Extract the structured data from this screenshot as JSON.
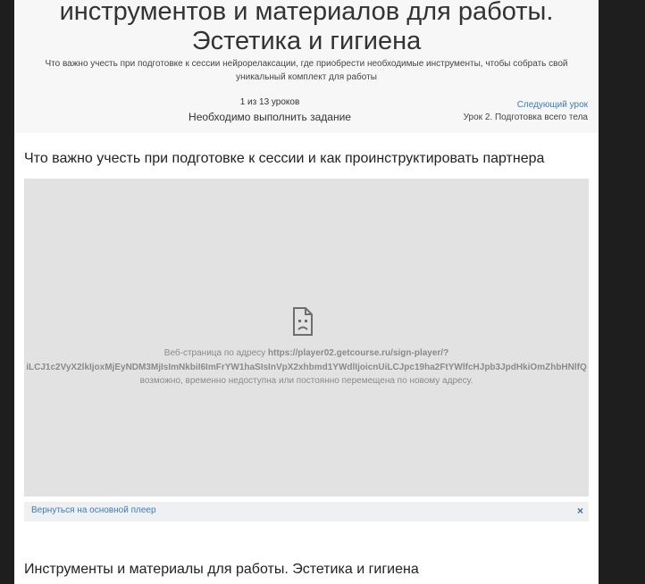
{
  "header": {
    "title_line_1": "инструментов и материалов для работы.",
    "title_line_2": "Эстетика и гигиена",
    "description": "Что важно учесть при подготовке к сессии нейрорелаксации, где приобрести необходимые инструменты, чтобы собрать свой уникальный комплект для работы",
    "progress": "1 из 13 уроков",
    "task_status": "Необходимо выполнить задание",
    "next_lesson_label": "Следующий урок",
    "next_lesson_title": "Урок 2. Подготовка всего тела"
  },
  "sections": [
    {
      "heading": "Что важно учесть при подготовке к сессии и как проинструктировать партнера"
    },
    {
      "heading": "Инструменты и материалы для работы. Эстетика и гигиена"
    }
  ],
  "player": {
    "error_prefix": "Веб-страница по адресу ",
    "error_url": "https://player02.getcourse.ru/sign-player/?",
    "error_url_cont": "iLCJ1c2VyX2lkIjoxMjEyNDM3MjIsImNkbiI6ImFrYW1haSIsInVpX2xhbmd1YWdlIjoicnUiLCJpc19ha2FtYWlfcHJpb3JpdHkiOmZhbHNlfQ",
    "error_suffix": "возможно, временно недоступна или постоянно перемещена по новому адресу.",
    "icon": "sad-document-icon",
    "back_link": "Вернуться на основной плеер",
    "close_symbol": "×"
  },
  "colors": {
    "link": "#3a7bbf",
    "player_bg": "#e2e2e2",
    "header_bg": "#f7f7f7"
  }
}
